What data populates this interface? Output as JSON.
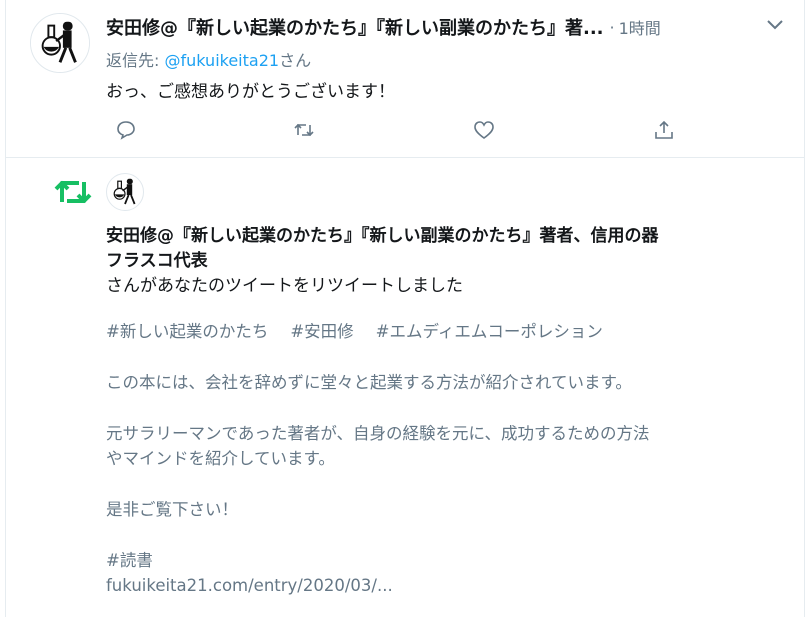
{
  "reply": {
    "author": "安田修@『新しい起業のかたち』『新しい副業のかたち』著...",
    "separator": "·",
    "time": "1時間",
    "reply_to_prefix": "返信先:",
    "reply_to_mention": "@fukuikeita21",
    "reply_to_suffix": "さん",
    "text": "おっ、ご感想ありがとうございます！",
    "icons": [
      "reply-icon",
      "retweet-icon",
      "like-icon",
      "share-icon",
      "chevron-down-icon"
    ]
  },
  "notification": {
    "user_line1": "安田修@『新しい起業のかたち』『新しい副業のかたち』著者、信用の器",
    "user_line2": "フラスコ代表",
    "action_text": "さんがあなたのツイートをリツイートしました",
    "icon_color": "#17bf63",
    "tweet": {
      "hashtags": [
        "#新しい起業のかたち",
        "#安田修",
        "#エムディエムコーポレション"
      ],
      "line1": "この本には、会社を辞めずに堂々と起業する方法が紹介されています。",
      "line2a": "元サラリーマンであった著者が、自身の経験を元に、成功するための方法",
      "line2b": "やマインドを紹介しています。",
      "line3": "是非ご覧下さい！",
      "tag": "#読書",
      "link": "fukuikeita21.com/entry/2020/03/..."
    }
  }
}
